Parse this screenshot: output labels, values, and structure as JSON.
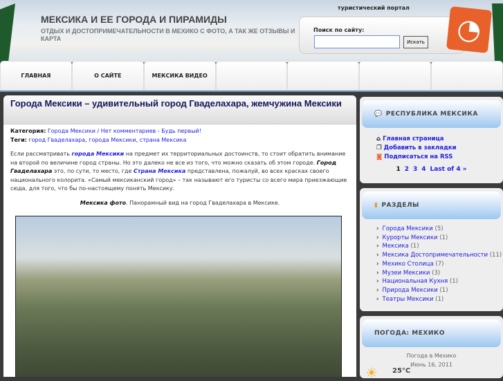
{
  "header": {
    "title": "МЕКСИКА И ЕЕ ГОРОДА И ПИРАМИДЫ",
    "description": "ОТДЫХ И ДОСТОПРИМЕЧАТЕЛЬНОСТИ В МЕХИКО С ФОТО, А ТАК ЖЕ ОТЗЫВЫ И КАРТА",
    "portal_label": "туристический портал"
  },
  "search": {
    "label": "Поиск по сайту:",
    "value": "",
    "button": "Искать"
  },
  "nav": [
    "ГЛАВНАЯ",
    "О САЙТЕ",
    "МЕКСИКА ВИДЕО",
    "",
    "",
    "",
    ""
  ],
  "post": {
    "title": "Города Мексики – удивительный город Гваделахара, жемчужина Мексики",
    "category_label": "Категория:",
    "category": "Города Мексики",
    "comments": "Нет комментариев - Будь первый!",
    "tags_label": "Теги:",
    "tags": [
      "город Гваделахара",
      "города Мексики",
      "страна Мексика"
    ],
    "p1": "Если рассматривать ",
    "l1": "города Мексики",
    "p2": " на предмет их территориальных достоинств, то стоит обратить внимание на второй по величине город страны. Но это далеко не все из того, что можно сказать об этом городе. ",
    "b1": "Город Гваделахара",
    "p3": " это, по сути, то место, где ",
    "l2": "Страна Мексика",
    "p4": " представлена, пожалуй, во всех красках своего национального колорита. «Самый мексиканский город» – так называют его туристы со всего мира приезжающие сюда, для того, что бы по-настоящему понять Мексику.",
    "caption_bold": "Мексика фото",
    "caption": ". Панорамный вид на город Гваделахара в Мексике."
  },
  "sidebar": {
    "w1": {
      "title": "РЕСПУБЛИКА МЕКСИКА",
      "links": [
        "Главная страница",
        "Добавить в закладки",
        "Подписаться на RSS"
      ],
      "pager": [
        "1",
        "2",
        "3",
        "4",
        "Last of 4 »"
      ]
    },
    "w2": {
      "title": "РАЗДЕЛЫ",
      "items": [
        {
          "label": "Города Мексики",
          "count": "(5)"
        },
        {
          "label": "Курорты Мексики",
          "count": "(1)"
        },
        {
          "label": "Мексика",
          "count": "(1)"
        },
        {
          "label": "Мексика Достопримечательности",
          "count": "(11)"
        },
        {
          "label": "Мехико Столица",
          "count": "(7)"
        },
        {
          "label": "Музеи Мексики",
          "count": "(3)"
        },
        {
          "label": "Национальная Кухня",
          "count": "(1)"
        },
        {
          "label": "Природа Мексики",
          "count": "(1)"
        },
        {
          "label": "Театры Мексики",
          "count": "(1)"
        }
      ]
    },
    "w3": {
      "title": "ПОГОДА: МЕХИКО",
      "line1": "Погода в Мехико",
      "date": "Июнь 16, 2011",
      "temp": "25°C"
    }
  }
}
